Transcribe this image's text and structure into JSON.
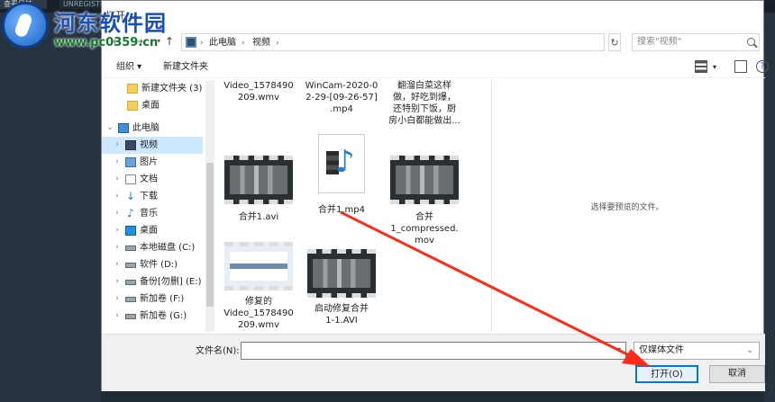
{
  "app": {
    "tab1": "查看日誌",
    "tab2": "UNREGISTERED"
  },
  "watermark": {
    "text": "河东软件园",
    "url": "www.pc0359.cn"
  },
  "dialog": {
    "title": "打开",
    "nav": {
      "back": "←",
      "forward": "→",
      "up": "↑"
    },
    "address": {
      "crumbs": [
        "此电脑",
        "视频"
      ]
    },
    "search": {
      "placeholder": "搜索\"视频\""
    },
    "toolbar": {
      "organize": "组织 ▾",
      "new_folder": "新建文件夹"
    },
    "nav_pane": {
      "items": [
        {
          "label": "新建文件夹 (3)",
          "icon": "folder-icon"
        },
        {
          "label": "桌面",
          "icon": "folder-icon"
        },
        {
          "label": "此电脑",
          "icon": "pc-icon"
        },
        {
          "label": "视频",
          "icon": "video-folder-icon"
        },
        {
          "label": "图片",
          "icon": "pictures-folder-icon"
        },
        {
          "label": "文档",
          "icon": "documents-folder-icon"
        },
        {
          "label": "下载",
          "icon": "download-icon"
        },
        {
          "label": "音乐",
          "icon": "music-icon"
        },
        {
          "label": "桌面",
          "icon": "desktop-icon"
        },
        {
          "label": "本地磁盘 (C:)",
          "icon": "drive-icon"
        },
        {
          "label": "软件 (D:)",
          "icon": "drive-icon"
        },
        {
          "label": "备份[勿删] (E:)",
          "icon": "drive-icon"
        },
        {
          "label": "新加卷 (F:)",
          "icon": "drive-icon"
        },
        {
          "label": "新加卷 (G:)",
          "icon": "drive-icon"
        }
      ]
    },
    "files": [
      {
        "name": "Video_1578490\n209.wmv"
      },
      {
        "name": "WinCam-2020-0\n2-29-[09-26-57]\n.mp4"
      },
      {
        "name": "翻溜白菜这样\n做，好吃到爆，\n还特别下饭，厨\n房小白都能做出..."
      },
      {
        "name": "合并1.avi"
      },
      {
        "name": "合并1.mp4"
      },
      {
        "name": "合并\n1_compressed.\nmov"
      },
      {
        "name": "修复的\nVideo_1578490\n209.wmv"
      },
      {
        "name": "启动修复合并\n1-1.AVI"
      }
    ],
    "preview": {
      "message": "选择要预览的文件。"
    },
    "bottom": {
      "filename_label": "文件名(N):",
      "filename_value": "",
      "filter": "仅媒体文件",
      "open_label": "打开(O)",
      "cancel_label": "取消"
    }
  },
  "colors": {
    "accent": "#0078d7",
    "selection": "#cce8ff",
    "arrow": "#ff2a1a"
  }
}
